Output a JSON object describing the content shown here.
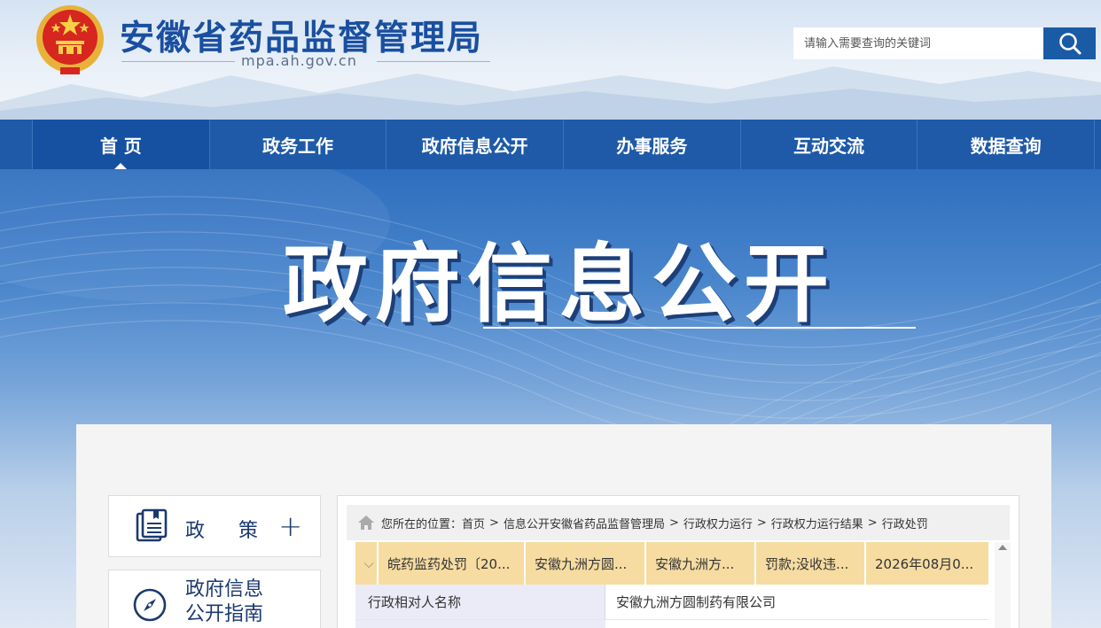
{
  "header": {
    "site_title": "安徽省药品监督管理局",
    "domain": "mpa.ah.gov.cn",
    "search_placeholder": "请输入需要查询的关键词"
  },
  "nav": {
    "items": [
      {
        "label": "首 页",
        "active": true
      },
      {
        "label": "政务工作"
      },
      {
        "label": "政府信息公开"
      },
      {
        "label": "办事服务"
      },
      {
        "label": "互动交流"
      },
      {
        "label": "数据查询"
      }
    ]
  },
  "banner": {
    "title": "政府信息公开"
  },
  "sidebar": {
    "policy": {
      "label": "政策",
      "expand_symbol": "+"
    },
    "guide": {
      "label_line1": "政府信息",
      "label_line2": "公开指南"
    }
  },
  "breadcrumb": {
    "prefix": "您所在的位置：",
    "items": [
      "首页",
      "信息公开安徽省药品监督管理局",
      "行政权力运行",
      "行政权力运行结果",
      "行政处罚"
    ],
    "separator": ">"
  },
  "record": {
    "toggle_symbol": "⌵",
    "columns": [
      "皖药监药处罚〔20...",
      "安徽九洲方圆...",
      "安徽九洲方...",
      "罚款;没收违...",
      "2026年08月0..."
    ],
    "details": [
      {
        "key": "行政相对人名称",
        "value": "安徽九洲方圆制药有限公司"
      }
    ]
  },
  "colors": {
    "brand_blue": "#1a4fa0",
    "nav_blue": "#1e5aa7",
    "header_row": "#f6dca1",
    "detail_key_bg": "#ebebf8"
  }
}
